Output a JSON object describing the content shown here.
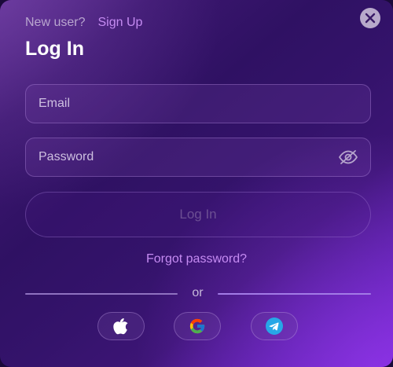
{
  "header": {
    "new_user_text": "New user?",
    "signup_label": "Sign Up",
    "title": "Log In"
  },
  "form": {
    "email_placeholder": "Email",
    "email_value": "",
    "password_placeholder": "Password",
    "password_value": "",
    "login_label": "Log In",
    "forgot_label": "Forgot password?"
  },
  "divider": {
    "text": "or"
  },
  "social": [
    {
      "icon": "apple-icon"
    },
    {
      "icon": "google-icon"
    },
    {
      "icon": "telegram-icon"
    }
  ],
  "colors": {
    "accent": "#c58bf2",
    "close_bg": "#b8a9cb",
    "disabled_button_text": "#6c4f93",
    "telegram": "#27a7e7"
  }
}
